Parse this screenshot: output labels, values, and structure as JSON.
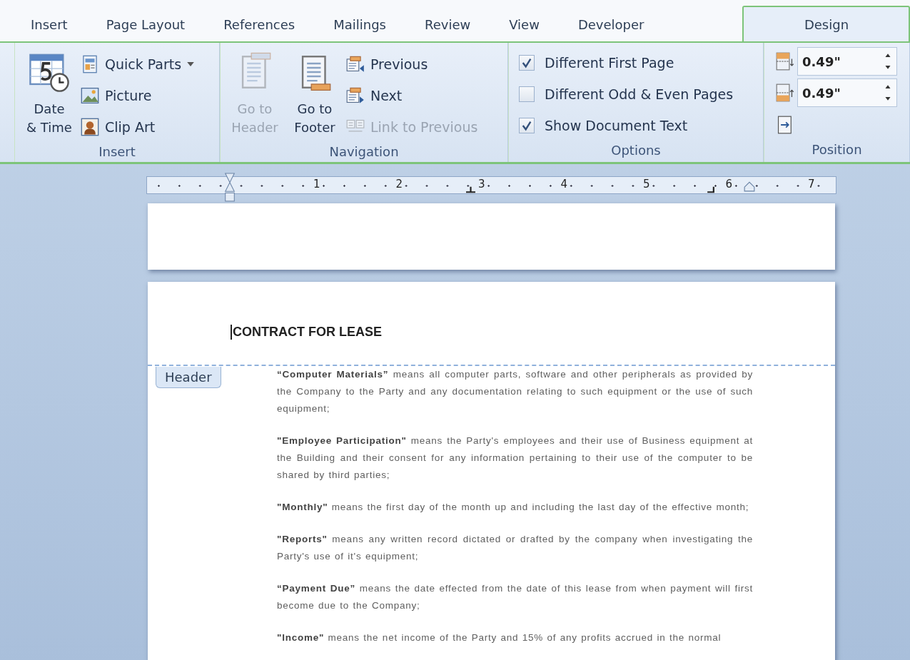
{
  "tabs": [
    {
      "label": "Insert",
      "selected": false
    },
    {
      "label": "Page Layout",
      "selected": false
    },
    {
      "label": "References",
      "selected": false
    },
    {
      "label": "Mailings",
      "selected": false
    },
    {
      "label": "Review",
      "selected": false
    },
    {
      "label": "View",
      "selected": false
    },
    {
      "label": "Developer",
      "selected": false
    },
    {
      "label": "Design",
      "selected": true
    }
  ],
  "ribbon": {
    "insert": {
      "label": "Insert",
      "large": {
        "label": "Date\n& Time"
      },
      "items": [
        {
          "label": "Quick Parts",
          "dropdown": true
        },
        {
          "label": "Picture",
          "dropdown": false
        },
        {
          "label": "Clip Art",
          "dropdown": false
        }
      ]
    },
    "navigation": {
      "label": "Navigation",
      "large": [
        {
          "label": "Go to Header",
          "disabled": true
        },
        {
          "label": "Go to Footer",
          "disabled": false
        }
      ],
      "items": [
        {
          "label": "Previous",
          "disabled": false
        },
        {
          "label": "Next",
          "disabled": false
        },
        {
          "label": "Link to Previous",
          "disabled": true
        }
      ]
    },
    "options": {
      "label": "Options",
      "items": [
        {
          "label": "Different First Page",
          "checked": true
        },
        {
          "label": "Different Odd & Even Pages",
          "checked": false
        },
        {
          "label": "Show Document Text",
          "checked": true
        }
      ]
    },
    "position": {
      "label": "Position",
      "spinners": [
        {
          "value": "0.49\""
        },
        {
          "value": "0.49\""
        }
      ]
    }
  },
  "ruler": {
    "numbers": [
      "1",
      "2",
      "3",
      "4",
      "5",
      "6",
      "7"
    ]
  },
  "document": {
    "title": "CONTRACT FOR LEASE",
    "header_tab": "Header",
    "paragraphs": [
      "**“Computer Materials”** means all computer parts, software and other peripherals as provided by the Company to the Party and any documentation relating to such equipment or the use of such equipment;",
      "**\"Employee Participation\"** means the Party's employees and their use of Business equipment at the Building and their consent for any information pertaining to their use of the computer to be shared by third parties;",
      "**\"Monthly\"** means the first day of the month up and including the last day of the effective month;",
      "**\"Reports\"** means any written record dictated or drafted by the company when investigating the Party's use of it's equipment;",
      "**“Payment Due”** means the date effected from the date of this lease from when payment will first become due to the Company;",
      "**\"Income\"** means the net income of the Party and 15% of any profits accrued in the normal"
    ]
  }
}
